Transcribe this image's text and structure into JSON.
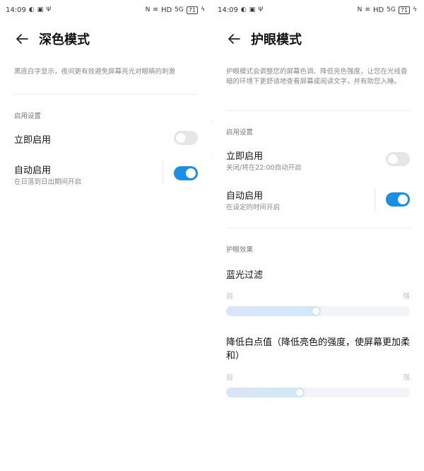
{
  "status_bar": {
    "time": "14:09",
    "network": "HD",
    "signal_gen": "5G",
    "battery": "71"
  },
  "dark_mode": {
    "title": "深色模式",
    "description": "黑底白字显示，夜间更有效避免屏幕亮光对眼睛的刺激",
    "section_header": "启用设置",
    "items": [
      {
        "title": "立即启用",
        "subtitle": "",
        "enabled": false
      },
      {
        "title": "自动启用",
        "subtitle": "在日落到日出期间开启",
        "enabled": true
      }
    ]
  },
  "eye_comfort": {
    "title": "护眼模式",
    "description": "护眼模式会调整您的屏幕色调、降低亮色强度，让您在光线昏暗的环境下更舒适地查看屏幕或阅读文字，并有助您入睡。",
    "section_header": "启用设置",
    "items": [
      {
        "title": "立即启用",
        "subtitle": "关闭/将在22:00自动开启",
        "enabled": false
      },
      {
        "title": "自动启用",
        "subtitle": "在设定的时间开启",
        "enabled": true
      }
    ],
    "effects_header": "护眼效果",
    "sliders": [
      {
        "label": "蓝光过滤",
        "min_label": "弱",
        "max_label": "强",
        "value": 0.5
      },
      {
        "label": "降低白点值（降低亮色的强度，使屏幕更加柔和）",
        "min_label": "弱",
        "max_label": "强",
        "value": 0.41
      }
    ]
  },
  "colors": {
    "accent": "#1a8fe8",
    "toggle_off": "#e6e6e6",
    "divider": "#ececec"
  },
  "icons": [
    "back-arrow-icon",
    "nfc-icon",
    "wifi-icon",
    "battery-icon"
  ]
}
